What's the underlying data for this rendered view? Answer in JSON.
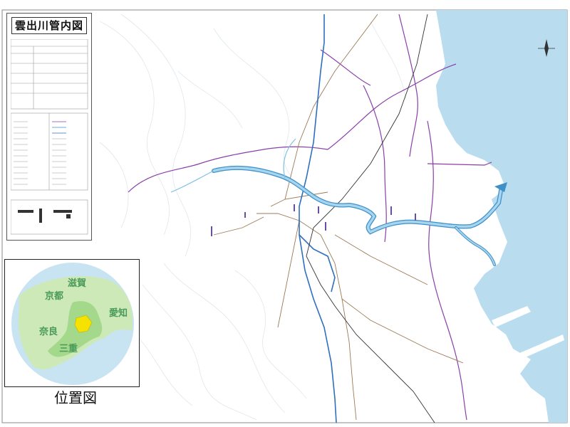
{
  "map": {
    "title": "雲出川管内図",
    "colors": {
      "sea": "#b9dcef",
      "river": "#7fc0e3",
      "river_edge": "#3f8fc8",
      "highway": "#2f6fbf",
      "boundary": "#8a3fa8",
      "road": "#9b7a55",
      "contour": "#d9e4ea",
      "land": "#ffffff"
    }
  },
  "locator": {
    "label": "位置図",
    "prefectures": [
      "滋賀",
      "京都",
      "愛知",
      "奈良",
      "三重"
    ],
    "colors": {
      "background": "#c8e4f2",
      "land": "#cde9b8",
      "mie": "#a4d98c",
      "highlight": "#f5e200"
    }
  }
}
